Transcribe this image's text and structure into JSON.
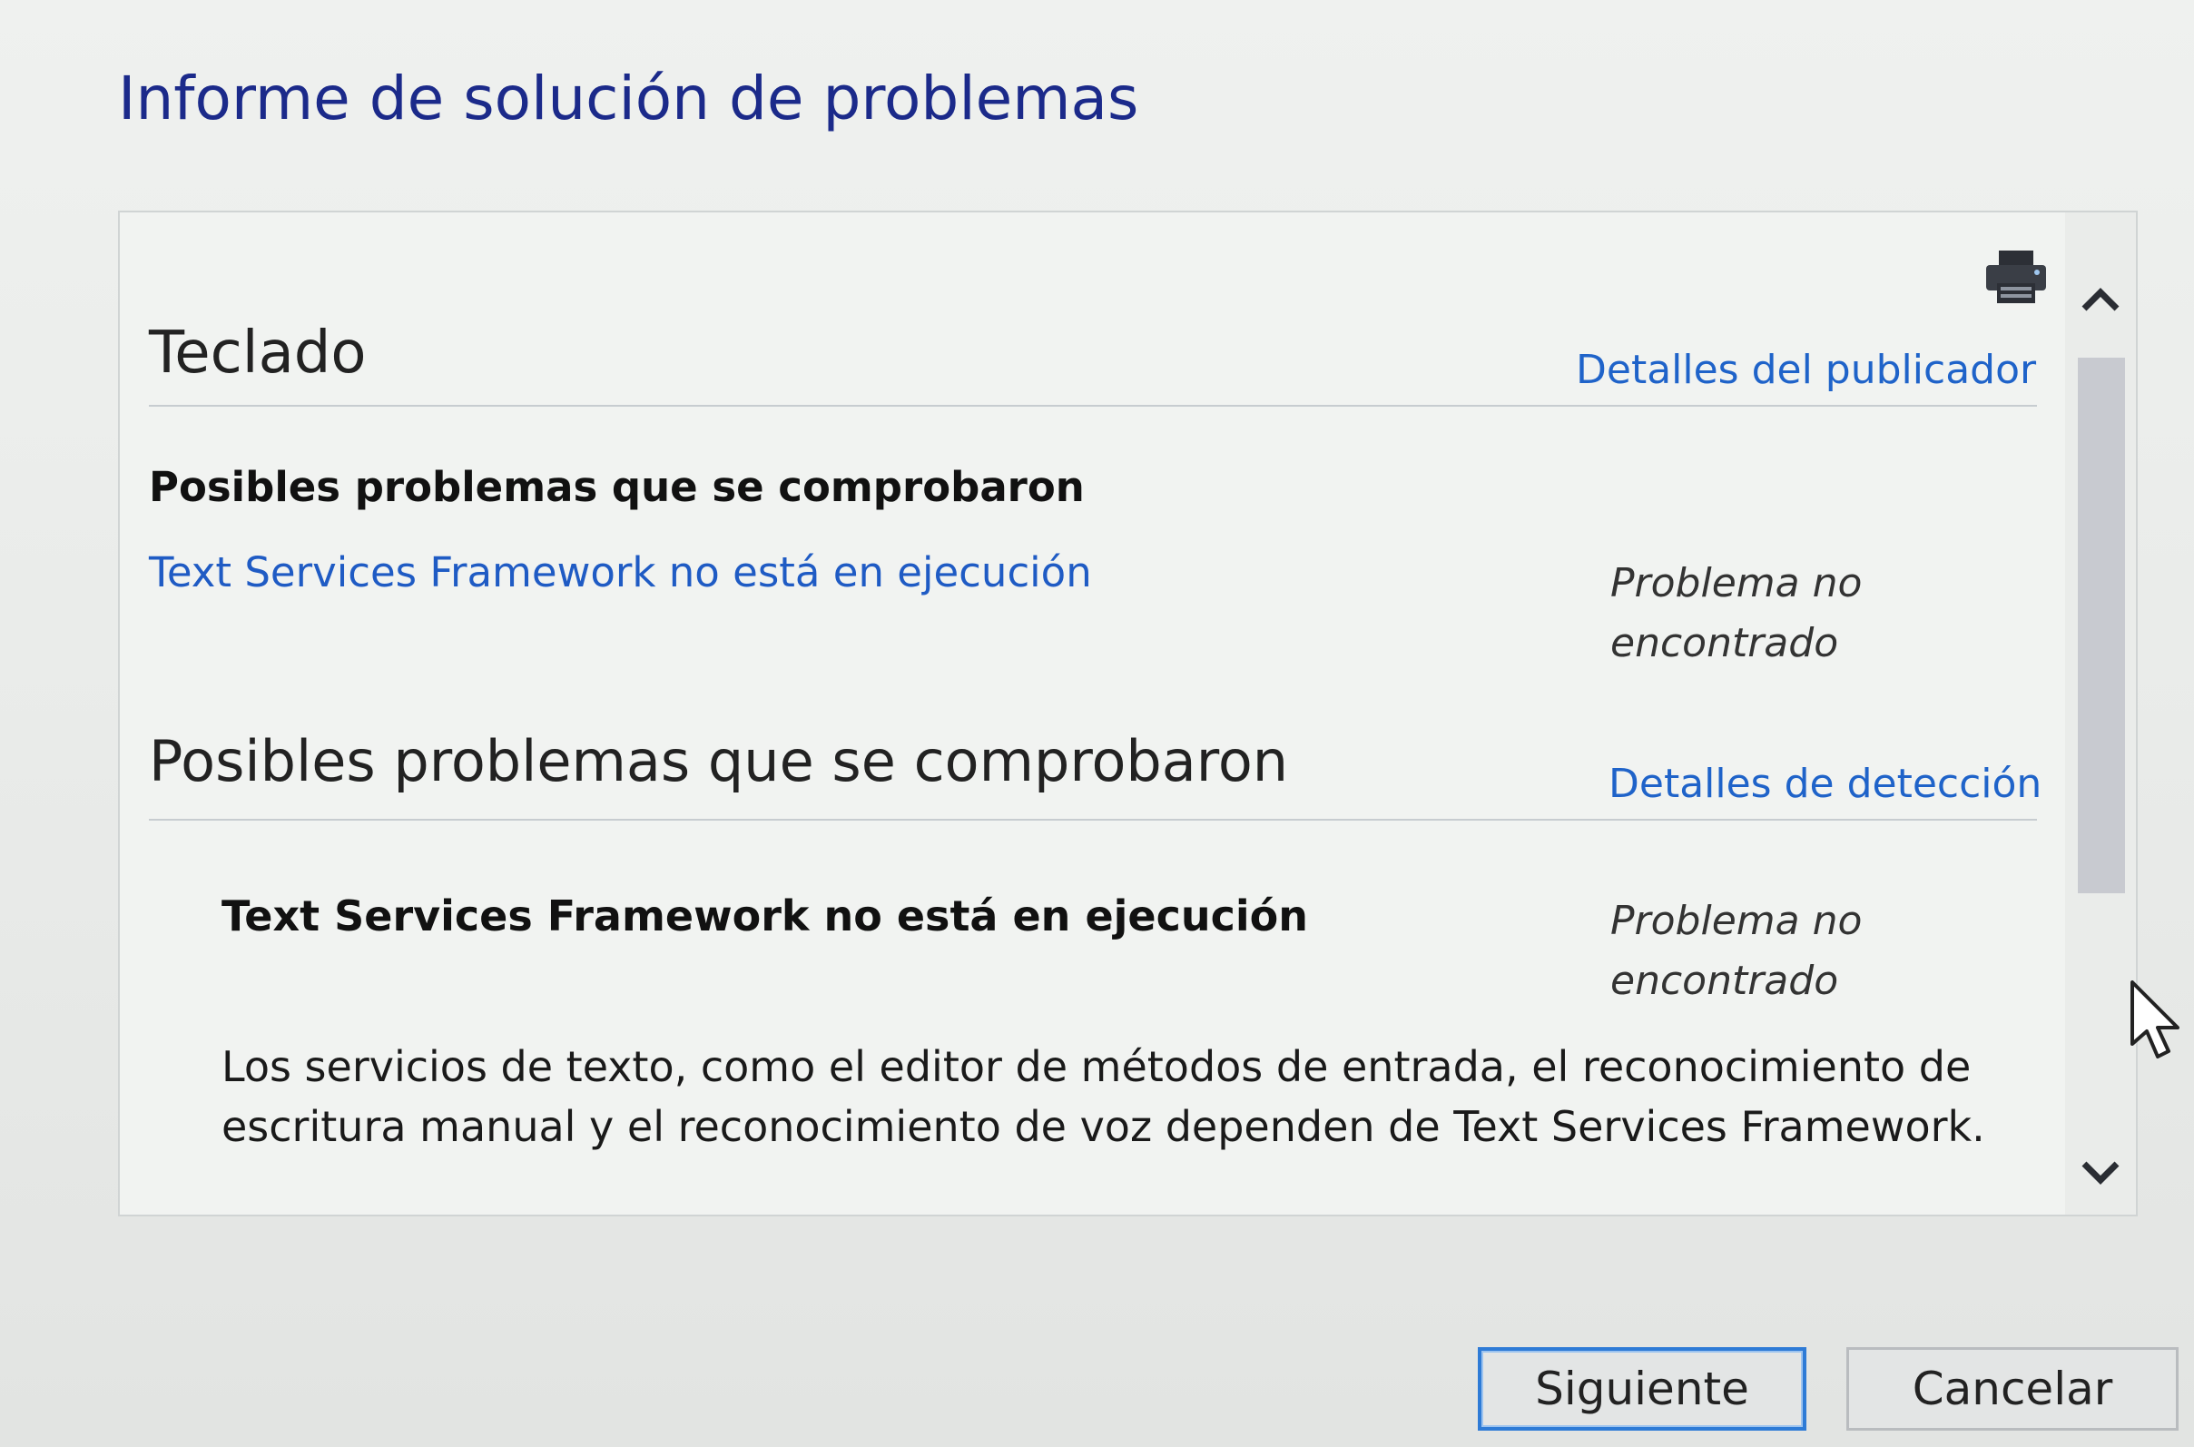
{
  "dialog": {
    "title": "Informe de solución de problemas"
  },
  "report": {
    "icons": {
      "print": "printer-icon",
      "scroll_up": "chevron-up-icon",
      "scroll_down": "chevron-down-icon",
      "pointer": "mouse-cursor-icon"
    },
    "package": {
      "title": "Teclado",
      "link": "Detalles del publicador",
      "subheading": "Posibles problemas que se comprobaron",
      "issue_link": "Text Services Framework no está en ejecución",
      "issue_status": "Problema no encontrado"
    },
    "detection": {
      "title": "Posibles problemas que se comprobaron",
      "link": "Detalles de detección",
      "issue_title": "Text Services Framework no está en ejecución",
      "issue_status": "Problema no encontrado",
      "description": "Los servicios de texto, como el editor de métodos de entrada, el reconocimiento de escritura manual y el reconocimiento de voz dependen de Text Services Framework."
    }
  },
  "buttons": {
    "next": "Siguiente",
    "cancel": "Cancelar"
  },
  "colors": {
    "title": "#1b2a8a",
    "link": "#1f63c9",
    "focus_border": "#2e7bd6"
  }
}
